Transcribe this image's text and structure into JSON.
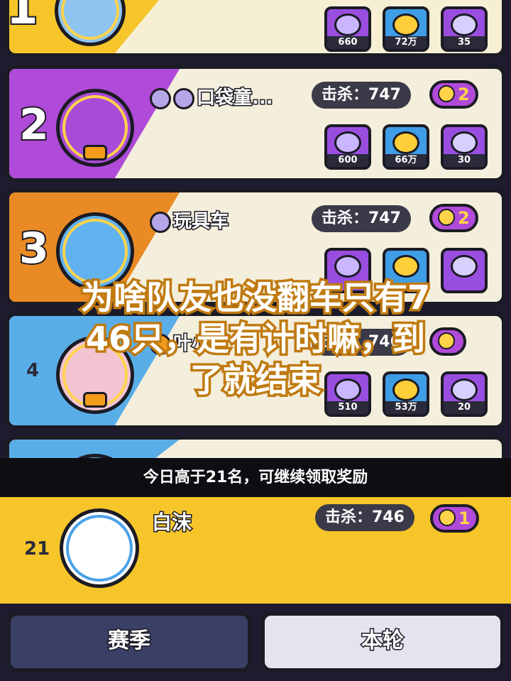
{
  "ranking": [
    {
      "rank": "1",
      "name": "",
      "kills": "",
      "skulls": "",
      "rewards": [
        "660",
        "72万",
        "35"
      ]
    },
    {
      "rank": "2",
      "name": "口袋童...",
      "kills": "击杀：747",
      "skulls": "2",
      "rewards": [
        "600",
        "66万",
        "30"
      ]
    },
    {
      "rank": "3",
      "name": "玩具车",
      "kills": "击杀：747",
      "skulls": "2",
      "rewards": [
        "",
        "",
        ""
      ]
    },
    {
      "rank": "4",
      "name": "叶小青",
      "kills": "击杀：746",
      "skulls": "",
      "rewards": [
        "510",
        "53万",
        "20"
      ]
    }
  ],
  "caption": {
    "line1": "为啥队友也没翻车只有7",
    "line2": "46只，是有计时嘛，到",
    "line3": "了就结束"
  },
  "notice": "今日高于21名，可继续领取奖励",
  "me": {
    "rank": "21",
    "name": "白沫",
    "kills": "击杀：746",
    "skulls": "1"
  },
  "tabs": {
    "season": "赛季",
    "round": "本轮"
  },
  "colors": {
    "accent": "#f6c52a",
    "purple": "#b04ad8",
    "dark": "#1b1b24"
  }
}
